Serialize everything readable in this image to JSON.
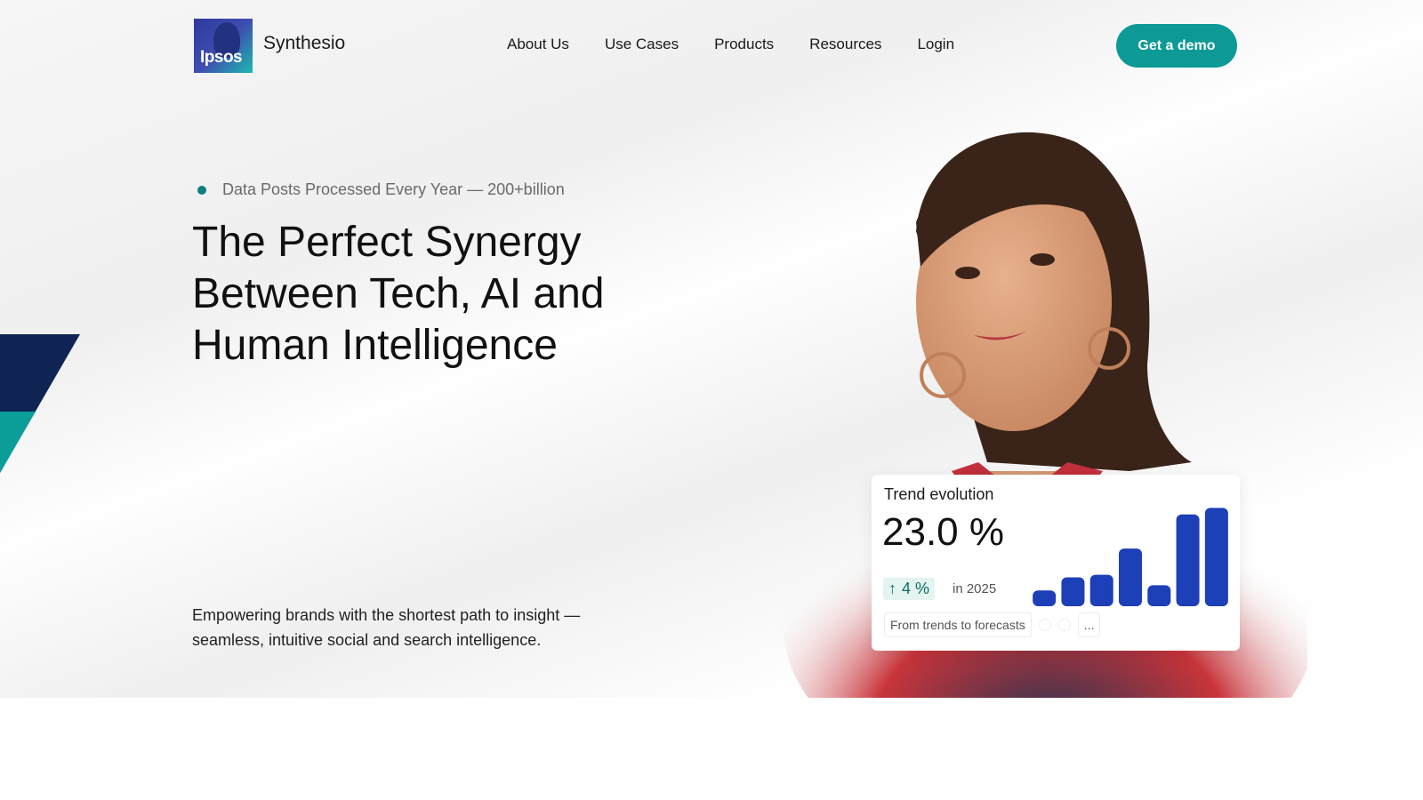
{
  "brand": {
    "logo_text": "Ipsos",
    "name": "Synthesio"
  },
  "nav": {
    "links": [
      "About Us",
      "Use Cases",
      "Products",
      "Resources",
      "Login"
    ],
    "cta": "Get a demo"
  },
  "hero": {
    "eyebrow": "Data Posts Processed Every Year — 200+billion",
    "headline": "The Perfect Synergy Between Tech, AI and Human Intelligence",
    "subcopy": "Empowering brands with the shortest path to insight — seamless, intuitive social and search intelligence."
  },
  "card": {
    "title": "Trend evolution",
    "value": "23.0 %",
    "delta": "4 %",
    "delta_icon": "arrow-up-icon",
    "year": "in 2025",
    "chip_label": "From trends to forecasts",
    "chip_more": "..."
  },
  "chart_data": {
    "type": "bar",
    "categories": [
      "",
      "",
      "",
      "",
      "",
      "",
      ""
    ],
    "values": [
      12,
      22,
      24,
      44,
      16,
      70,
      75
    ],
    "ylim": [
      0,
      80
    ],
    "color": "#1d3fb8"
  },
  "colors": {
    "accent": "#0d9a96",
    "navy": "#0f2452",
    "bars": "#1d3fb8"
  }
}
